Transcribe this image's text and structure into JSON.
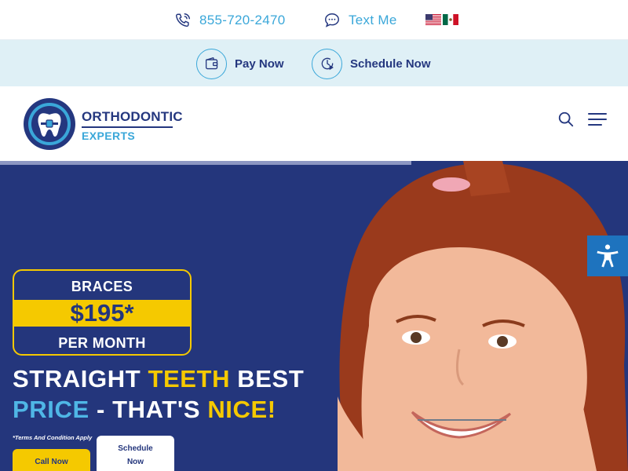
{
  "topbar": {
    "phone_icon": "phone-icon",
    "phone": "855-720-2470",
    "text_icon": "chat-bubble-icon",
    "text_label": "Text Me",
    "flags": [
      "us-flag",
      "mexico-flag"
    ]
  },
  "actions": {
    "pay_icon": "wallet-icon",
    "pay_label": "Pay Now",
    "schedule_icon": "clock-play-icon",
    "schedule_label": "Schedule Now"
  },
  "brand": {
    "line1": "ORTHODONTIC",
    "line2": "EXPERTS",
    "logo_icon": "tooth-braces-logo"
  },
  "nav": {
    "search_icon": "search-icon",
    "menu_icon": "hamburger-menu-icon"
  },
  "hero": {
    "price_title": "BRACES",
    "price_value": "$195*",
    "price_period": "PER MONTH",
    "headline": {
      "w1": "STRAIGHT ",
      "w2": "TEETH",
      "w3": " BEST",
      "w4": "PRICE",
      "w5": " - THAT'S ",
      "w6": "NICE!"
    },
    "terms": "*Terms And Condition Apply",
    "cta_call": "Call Now",
    "cta_schedule": "Schedule Now"
  },
  "accessibility": {
    "icon": "accessibility-person-icon"
  },
  "colors": {
    "navy": "#24367c",
    "yellow": "#f5c900",
    "light_blue": "#3aa7d9",
    "action_bg": "#dff0f6",
    "access_blue": "#1e73be"
  }
}
